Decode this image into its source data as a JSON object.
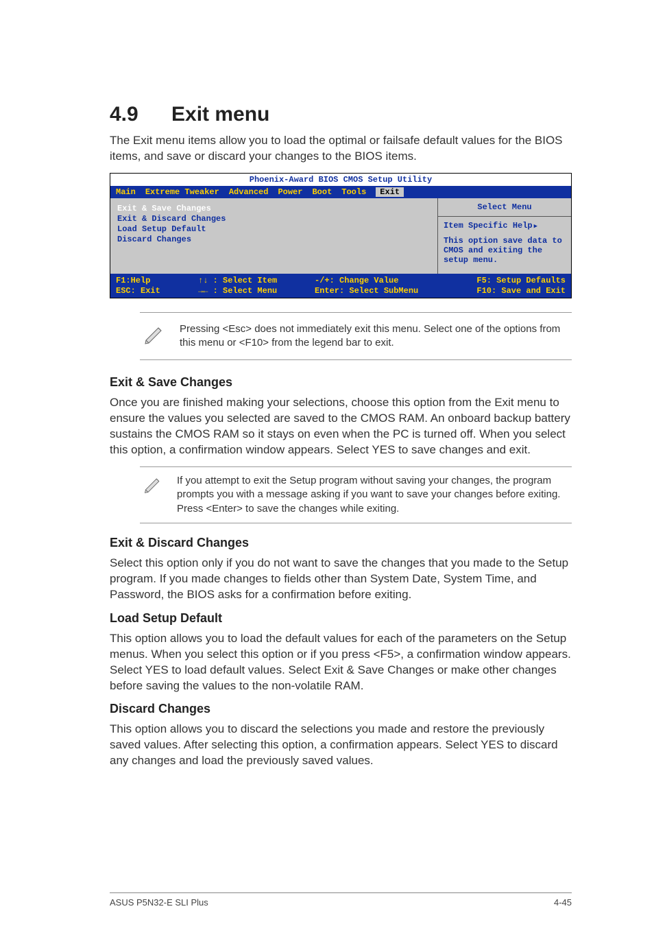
{
  "heading": {
    "number": "4.9",
    "title": "Exit menu"
  },
  "intro": "The Exit menu items allow you to load the optimal or failsafe default values for the BIOS items, and save or discard your changes to the BIOS items.",
  "bios": {
    "title": "Phoenix-Award BIOS CMOS Setup Utility",
    "tabs": [
      "Main",
      "Extreme Tweaker",
      "Advanced",
      "Power",
      "Boot",
      "Tools",
      "Exit"
    ],
    "active_tab_index": 6,
    "left_items": [
      "Exit & Save Changes",
      "Exit & Discard Changes",
      "Load Setup Default",
      "Discard Changes"
    ],
    "right_header": "Select Menu",
    "right_item": "Item Specific Help",
    "right_desc": "This option save data to CMOS and exiting the setup menu.",
    "footer": {
      "f1": "F1:Help",
      "esc": "ESC: Exit",
      "updown": "↑↓ : Select Item",
      "leftright": "→← : Select Menu",
      "change": "-/+:  Change Value",
      "enter": "Enter: Select SubMenu",
      "f5": "F5: Setup Defaults",
      "f10": "F10: Save and Exit"
    }
  },
  "note1": "Pressing <Esc> does not immediately exit this menu. Select one of the options from this menu or <F10> from the legend bar to exit.",
  "sec1": {
    "title": "Exit & Save Changes",
    "body": "Once you are finished making your selections, choose this option from the Exit menu to ensure the values you selected are saved to the CMOS RAM. An onboard backup battery sustains the CMOS RAM so it stays on even when the PC is turned off. When you select this option, a confirmation window appears. Select YES to save changes and exit."
  },
  "note2": "If you attempt to exit the Setup program without saving your changes, the program prompts you with a message asking if you want to save your changes before exiting. Press <Enter> to save the changes while exiting.",
  "sec2": {
    "title": "Exit & Discard Changes",
    "body": "Select this option only if you do not want to save the changes that you made to the Setup program. If you made changes to fields other than System Date, System Time, and Password, the BIOS asks for a confirmation before exiting."
  },
  "sec3": {
    "title": "Load Setup Default",
    "body": "This option allows you to load the default values for each of the parameters on the Setup menus. When you select this option or if you press <F5>, a confirmation window appears. Select YES to load default values. Select Exit & Save Changes or make other changes before saving the values to the non-volatile RAM."
  },
  "sec4": {
    "title": "Discard Changes",
    "body": "This option allows you to discard the selections you made and restore the previously saved values. After selecting this option, a confirmation appears. Select YES to discard any changes and load the previously saved values."
  },
  "footer": {
    "left": "ASUS P5N32-E SLI Plus",
    "right": "4-45"
  }
}
